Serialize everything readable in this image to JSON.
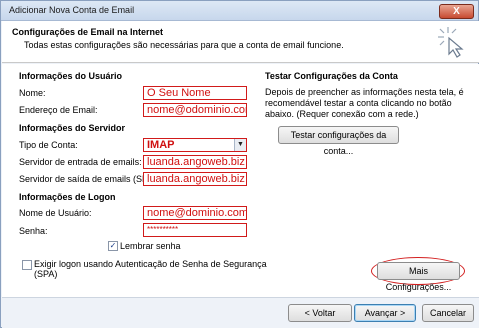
{
  "window": {
    "title": "Adicionar Nova Conta de Email",
    "close_glyph": "X"
  },
  "header": {
    "title": "Configurações de Email na Internet",
    "subtitle": "Todas estas configurações são necessárias para que a conta de email funcione."
  },
  "user_info": {
    "heading": "Informações do Usuário",
    "name_label": "Nome:",
    "name_value": "O Seu Nome",
    "email_label": "Endereço de Email:",
    "email_value": "nome@odominio.com"
  },
  "server_info": {
    "heading": "Informações do Servidor",
    "account_type_label": "Tipo de Conta:",
    "account_type_value": "IMAP",
    "incoming_label": "Servidor de entrada de emails:",
    "incoming_value": "luanda.angoweb.biz",
    "outgoing_label": "Servidor de saída de emails (SMTP):",
    "outgoing_value": "luanda.angoweb.biz"
  },
  "logon_info": {
    "heading": "Informações de Logon",
    "username_label": "Nome de Usuário:",
    "username_value": "nome@dominio.com",
    "password_label": "Senha:",
    "password_value": "**********",
    "remember_label": "Lembrar senha",
    "remember_checked": true,
    "spa_label_line1": "Exigir logon usando Autenticação de Senha de Segurança",
    "spa_label_line2": "(SPA)",
    "spa_checked": false
  },
  "test_settings": {
    "heading": "Testar Configurações da Conta",
    "description": "Depois de preencher as informações nesta tela, é recomendável testar a conta clicando no botão abaixo. (Requer conexão com a rede.)",
    "test_button": "Testar configurações da conta..."
  },
  "more_settings_button": "Mais Configurações...",
  "footer": {
    "back_button": "< Voltar",
    "next_button": "Avançar >",
    "cancel_button": "Cancelar"
  },
  "colors": {
    "highlight_red": "#d32020",
    "value_red": "#d01010",
    "default_button_border": "#3c7fb1"
  }
}
